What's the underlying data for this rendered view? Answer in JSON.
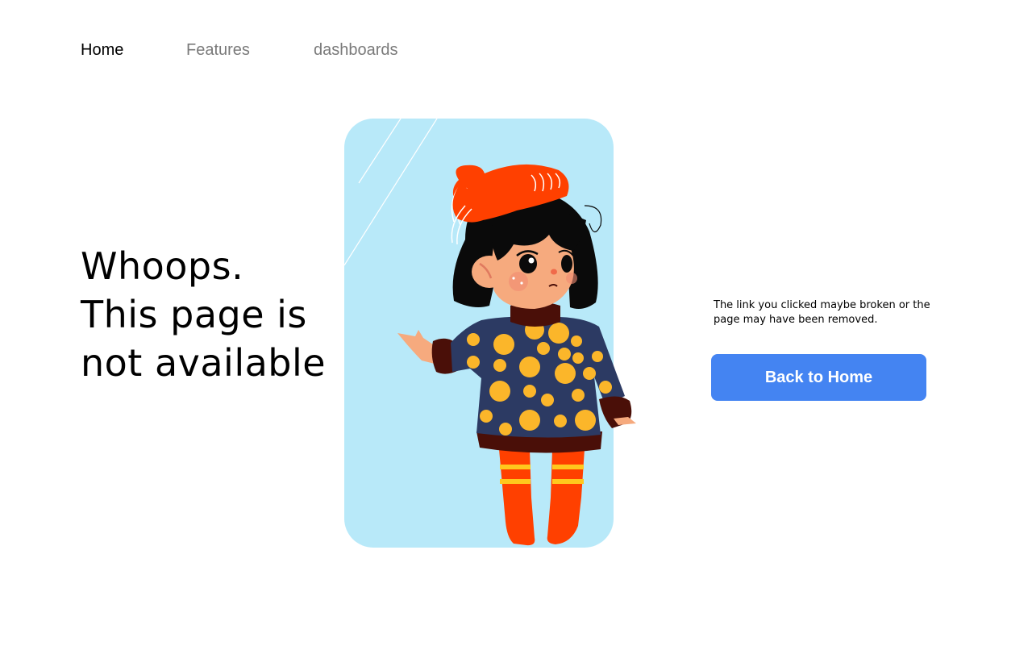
{
  "nav": {
    "items": [
      {
        "label": "Home",
        "active": true
      },
      {
        "label": "Features",
        "active": false
      },
      {
        "label": "dashboards",
        "active": false
      }
    ]
  },
  "hero": {
    "title_lines": [
      "Whoops.",
      "This page is",
      "not available"
    ]
  },
  "message": {
    "text": "The link you clicked maybe broken or the page may have been removed."
  },
  "cta": {
    "label": "Back to Home"
  },
  "colors": {
    "accent": "#4484F2",
    "illustration_bg": "#B8E9F9",
    "beret": "#FF4000",
    "sweater": "#2C3A63",
    "dots": "#FBB62A",
    "skin": "#F6AA7E",
    "hair": "#0A0A0A",
    "collar": "#4A0F08",
    "stripe": "#FFC81D"
  }
}
